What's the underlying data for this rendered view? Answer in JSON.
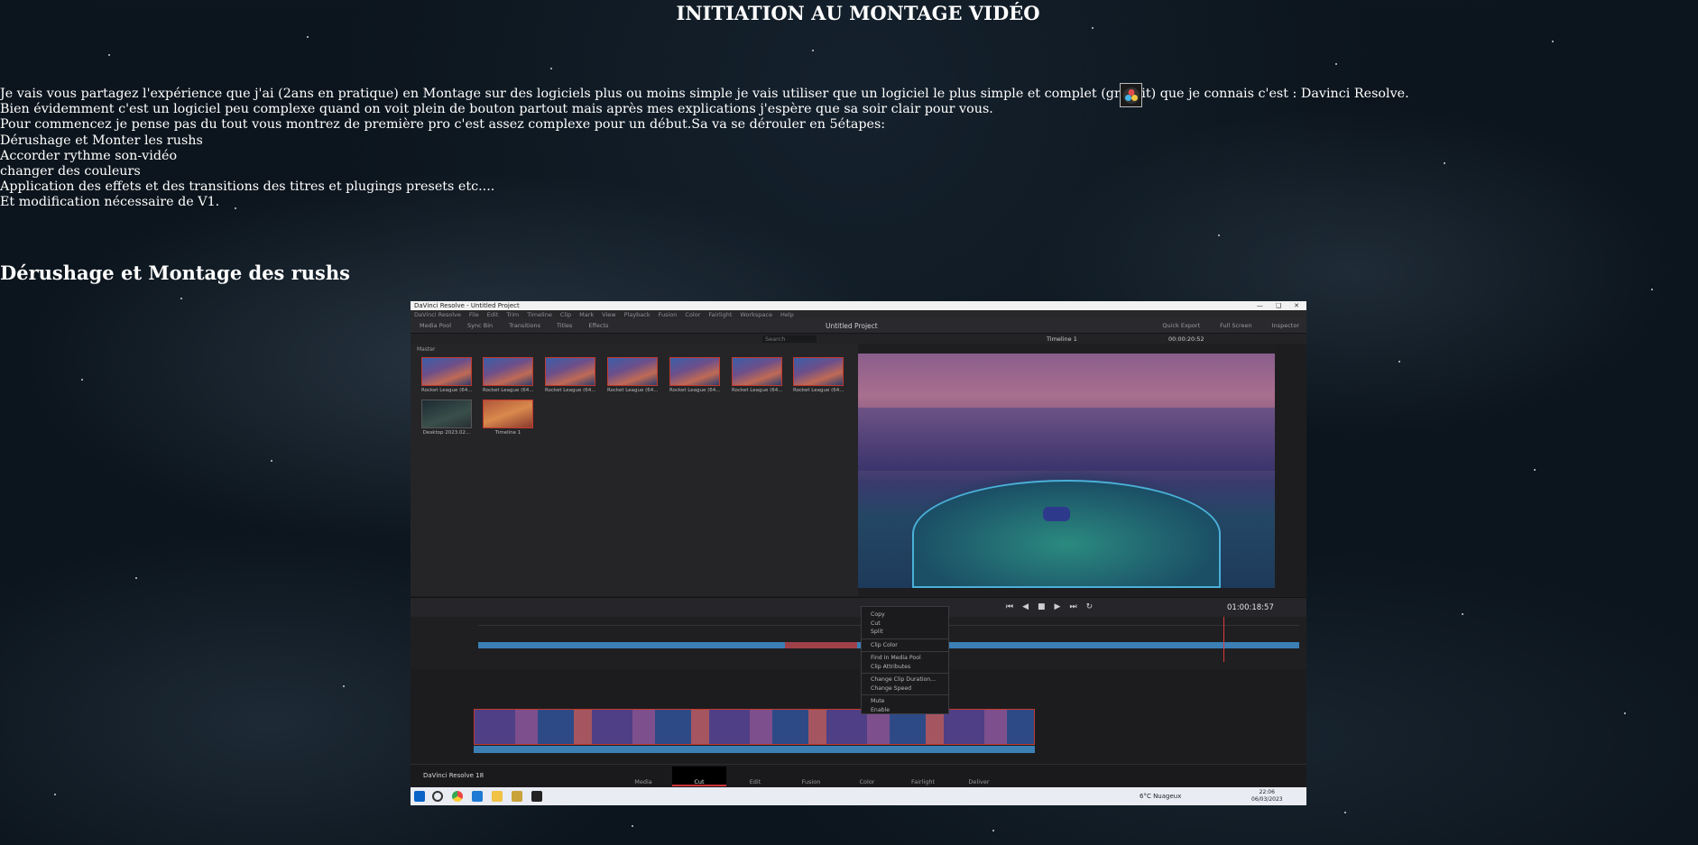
{
  "page": {
    "title": "INITIATION AU MONTAGE VIDÉO",
    "intro_lines": [
      "Je vais vous partagez l'expérience que j'ai (2ans en pratique) en Montage sur des logiciels plus ou moins simple je vais utiliser que un logiciel le plus simple et complet (gratuit) que je connais c'est : Davinci Resolve.",
      "Bien évidemment c'est un logiciel peu complexe quand on voit plein de bouton partout mais après mes explications j'espère que sa soir clair pour vous.",
      "Pour commencez je pense pas du tout vous montrez de première pro c'est assez complexe pour un début.Sa va se dérouler en 5étapes:",
      "Dérushage et Monter les rushs",
      "Accorder rythme son-vidéo",
      "changer des couleurs",
      "Application des effets et des transitions des titres et plugings presets etc....",
      "Et modification nécessaire de V1."
    ],
    "section_title": "Dérushage et Montage des rushs"
  },
  "resolve": {
    "window_title": "DaVinci Resolve - Untitled Project",
    "menu": [
      "DaVinci Resolve",
      "File",
      "Edit",
      "Trim",
      "Timeline",
      "Clip",
      "Mark",
      "View",
      "Playback",
      "Fusion",
      "Color",
      "Fairlight",
      "Workspace",
      "Help"
    ],
    "toolbar_left": [
      "Media Pool",
      "Sync Bin",
      "Transitions",
      "Titles",
      "Effects"
    ],
    "project_name": "Untitled Project",
    "toolbar_right": [
      "Quick Export",
      "Full Screen",
      "Inspector"
    ],
    "search_placeholder": "Search",
    "timeline_name": "Timeline 1",
    "timecode_top": "00:00:20:52",
    "bin_name": "Master",
    "clips": [
      "Rocket League (64...",
      "Rocket League (64...",
      "Rocket League (64...",
      "Rocket League (64...",
      "Rocket League (64...",
      "Rocket League (64...",
      "Rocket League (64...",
      "Desktop 2023.02...",
      "Timeline 1"
    ],
    "timecode": "01:00:18:57",
    "context_menu": [
      "Copy",
      "Cut",
      "Split",
      "Clip Color",
      "Find In Media Pool",
      "Clip Attributes",
      "Change Clip Duration...",
      "Change Speed",
      "Mute",
      "Enable"
    ],
    "brand": "DaVinci Resolve 18",
    "pages": [
      "Media",
      "Cut",
      "Edit",
      "Fusion",
      "Color",
      "Fairlight",
      "Deliver"
    ],
    "active_page": "Cut",
    "weather": "6°C Nuageux",
    "clock_time": "22:06",
    "clock_date": "06/03/2023"
  }
}
